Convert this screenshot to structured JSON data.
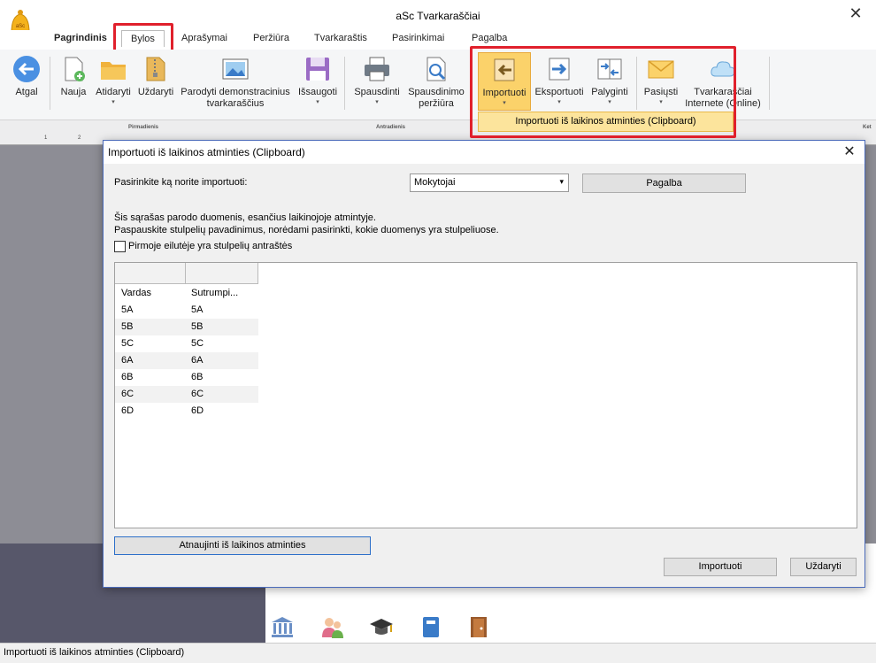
{
  "app": {
    "title": "aSc Tvarkaraščiai",
    "logo_text": "aSc"
  },
  "menu": {
    "tabs": [
      "Pagrindinis",
      "Bylos",
      "Aprašymai",
      "Peržiūra",
      "Tvarkaraštis",
      "Pasirinkimai",
      "Pagalba"
    ],
    "active": "Bylos"
  },
  "ribbon": {
    "back": "Atgal",
    "new": "Nauja",
    "open": "Atidaryti",
    "close": "Uždaryti",
    "demo_line1": "Parodyti demonstracinius",
    "demo_line2": "tvarkaraščius",
    "save": "Išsaugoti",
    "print": "Spausdinti",
    "preview_line1": "Spausdinimo",
    "preview_line2": "peržiūra",
    "import": "Importuoti",
    "export": "Eksportuoti",
    "compare": "Palyginti",
    "send": "Pasiųsti",
    "online_line1": "Tvarkaraščiai",
    "online_line2": "Internete (Online)",
    "drop": "▾"
  },
  "import_menu_item": "Importuoti iš laikinos atminties (Clipboard)",
  "schedule": {
    "days": [
      "Pirmadienis",
      "Antradienis",
      "Ket"
    ],
    "numbers": [
      "1",
      "2"
    ]
  },
  "dialog": {
    "title": "Importuoti iš laikinos atminties (Clipboard)",
    "choose_label": "Pasirinkite ką norite importuoti:",
    "choose_value": "Mokytojai",
    "help_button": "Pagalba",
    "info_line1": "Šis sąrašas parodo duomenis, esančius laikinojoje atmintyje.",
    "info_line2": "Paspauskite stulpelių pavadinimus, norėdami pasirinkti, kokie duomenys yra stulpeliuose.",
    "first_row_header": "Pirmoje eilutėje yra stulpelių antraštės",
    "columns": [
      "Vardas",
      "Sutrumpi..."
    ],
    "rows": [
      [
        "5A",
        "5A"
      ],
      [
        "5B",
        "5B"
      ],
      [
        "5C",
        "5C"
      ],
      [
        "6A",
        "6A"
      ],
      [
        "6B",
        "6B"
      ],
      [
        "6C",
        "6C"
      ],
      [
        "6D",
        "6D"
      ]
    ],
    "refresh_button": "Atnaujinti iš laikinos atminties",
    "import_button": "Importuoti",
    "close_button": "Uždaryti"
  },
  "status": "Importuoti iš laikinos atminties (Clipboard)",
  "colors": {
    "highlight": "#fbd26a",
    "annotation_red": "#e0202c",
    "accent_blue": "#2c6fc9"
  }
}
